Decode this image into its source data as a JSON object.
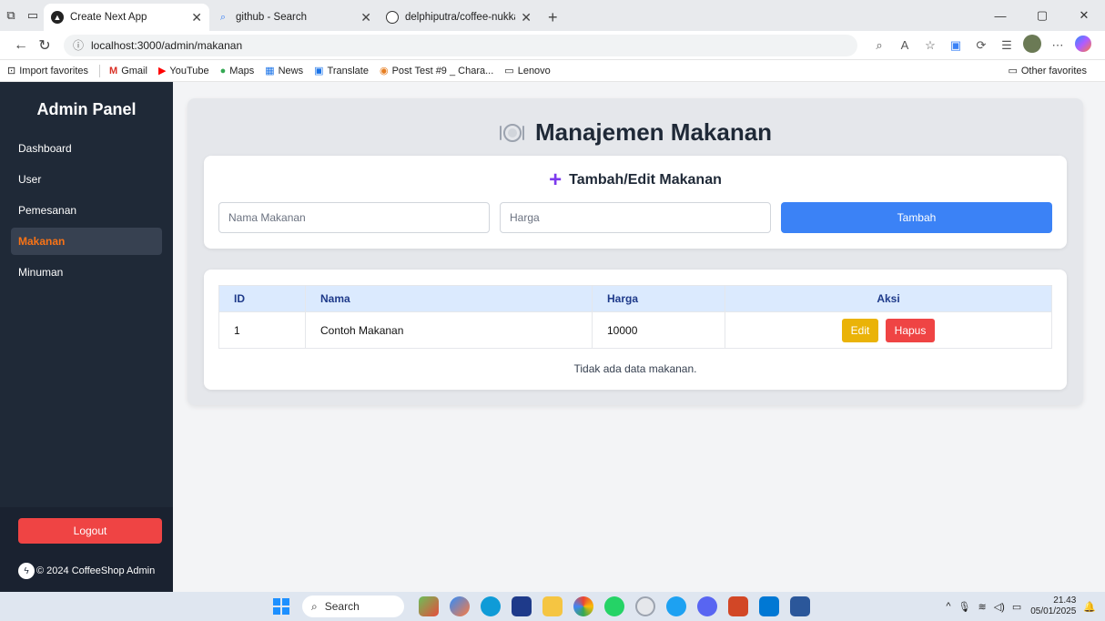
{
  "browser": {
    "tabs": [
      {
        "title": "Create Next App",
        "active": true
      },
      {
        "title": "github - Search",
        "active": false
      },
      {
        "title": "delphiputra/coffee-nukka",
        "active": false
      }
    ],
    "url": "localhost:3000/admin/makanan",
    "favorites": [
      {
        "label": "Import favorites",
        "icon": "import-icon"
      },
      {
        "label": "Gmail",
        "icon": "gmail-icon"
      },
      {
        "label": "YouTube",
        "icon": "youtube-icon"
      },
      {
        "label": "Maps",
        "icon": "maps-icon"
      },
      {
        "label": "News",
        "icon": "news-icon"
      },
      {
        "label": "Translate",
        "icon": "translate-icon"
      },
      {
        "label": "Post Test #9 _ Chara...",
        "icon": "site-icon"
      },
      {
        "label": "Lenovo",
        "icon": "folder-icon"
      }
    ],
    "other_favorites": "Other favorites"
  },
  "sidebar": {
    "title": "Admin Panel",
    "items": [
      {
        "label": "Dashboard",
        "active": false
      },
      {
        "label": "User",
        "active": false
      },
      {
        "label": "Pemesanan",
        "active": false
      },
      {
        "label": "Makanan",
        "active": true
      },
      {
        "label": "Minuman",
        "active": false
      }
    ],
    "logout_label": "Logout",
    "footer": "© 2024 CoffeeShop Admin"
  },
  "main": {
    "page_title": "Manajemen Makanan",
    "form": {
      "title": "Tambah/Edit Makanan",
      "name_placeholder": "Nama Makanan",
      "price_placeholder": "Harga",
      "submit_label": "Tambah"
    },
    "table": {
      "headers": [
        "ID",
        "Nama",
        "Harga",
        "Aksi"
      ],
      "rows": [
        {
          "id": "1",
          "name": "Contoh Makanan",
          "price": "10000",
          "edit_label": "Edit",
          "delete_label": "Hapus"
        }
      ],
      "empty_text": "Tidak ada data makanan."
    }
  },
  "taskbar": {
    "search_label": "Search",
    "time": "21.43",
    "date": "05/01/2025"
  },
  "colors": {
    "sidebar_bg": "#1f2937",
    "active_menu": "#f97316",
    "primary": "#3b82f6",
    "danger": "#ef4444",
    "warning": "#eab308",
    "header_bg": "#dbeafe"
  }
}
